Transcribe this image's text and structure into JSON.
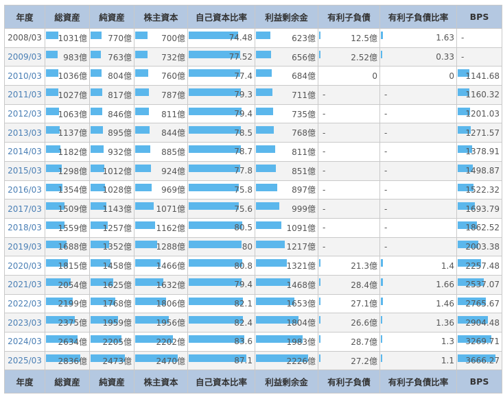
{
  "header": [
    "年度",
    "総資産",
    "純資産",
    "株主資本",
    "自己資本比率",
    "利益剰余金",
    "有利子負債",
    "有利子負債比率",
    "BPS"
  ],
  "no_data": "-",
  "rows": [
    {
      "year": "2008/03",
      "assets": 1031,
      "net": 770,
      "equity": 700,
      "ratio": 74.48,
      "retained": 623,
      "debt": 12.5,
      "debt_unit": "億",
      "debt_ratio": 1.63,
      "bps": null
    },
    {
      "year": "2009/03",
      "assets": 983,
      "net": 763,
      "equity": 732,
      "ratio": 77.52,
      "retained": 656,
      "debt": 2.52,
      "debt_unit": "億",
      "debt_ratio": 0.33,
      "bps": null
    },
    {
      "year": "2010/03",
      "assets": 1036,
      "net": 804,
      "equity": 760,
      "ratio": 77.4,
      "retained": 684,
      "debt": 0,
      "debt_unit": "",
      "debt_ratio": 0,
      "bps": 1141.68
    },
    {
      "year": "2011/03",
      "assets": 1027,
      "net": 817,
      "equity": 787,
      "ratio": 79.3,
      "retained": 711,
      "debt": null,
      "debt_ratio": null,
      "bps": 1160.32
    },
    {
      "year": "2012/03",
      "assets": 1063,
      "net": 846,
      "equity": 811,
      "ratio": 79.4,
      "retained": 735,
      "debt": null,
      "debt_ratio": null,
      "bps": 1201.03
    },
    {
      "year": "2013/03",
      "assets": 1137,
      "net": 895,
      "equity": 844,
      "ratio": 78.5,
      "retained": 768,
      "debt": null,
      "debt_ratio": null,
      "bps": 1271.57
    },
    {
      "year": "2014/03",
      "assets": 1182,
      "net": 932,
      "equity": 885,
      "ratio": 78.7,
      "retained": 811,
      "debt": null,
      "debt_ratio": null,
      "bps": 1378.91
    },
    {
      "year": "2015/03",
      "assets": 1298,
      "net": 1012,
      "equity": 924,
      "ratio": 77.8,
      "retained": 851,
      "debt": null,
      "debt_ratio": null,
      "bps": 1498.87
    },
    {
      "year": "2016/03",
      "assets": 1354,
      "net": 1028,
      "equity": 969,
      "ratio": 75.8,
      "retained": 897,
      "debt": null,
      "debt_ratio": null,
      "bps": 1522.32
    },
    {
      "year": "2017/03",
      "assets": 1509,
      "net": 1143,
      "equity": 1071,
      "ratio": 75.6,
      "retained": 999,
      "debt": null,
      "debt_ratio": null,
      "bps": 1693.79
    },
    {
      "year": "2018/03",
      "assets": 1559,
      "net": 1257,
      "equity": 1162,
      "ratio": 80.5,
      "retained": 1091,
      "debt": null,
      "debt_ratio": null,
      "bps": 1862.52
    },
    {
      "year": "2019/03",
      "assets": 1688,
      "net": 1352,
      "equity": 1288,
      "ratio": 80,
      "retained": 1217,
      "debt": null,
      "debt_ratio": null,
      "bps": 2003.38
    },
    {
      "year": "2020/03",
      "assets": 1815,
      "net": 1458,
      "equity": 1466,
      "ratio": 80.8,
      "retained": 1321,
      "debt": 21.3,
      "debt_unit": "億",
      "debt_ratio": 1.4,
      "bps": 2257.48
    },
    {
      "year": "2021/03",
      "assets": 2054,
      "net": 1625,
      "equity": 1632,
      "ratio": 79.4,
      "retained": 1468,
      "debt": 28.4,
      "debt_unit": "億",
      "debt_ratio": 1.66,
      "bps": 2537.07
    },
    {
      "year": "2022/03",
      "assets": 2199,
      "net": 1768,
      "equity": 1806,
      "ratio": 82.1,
      "retained": 1653,
      "debt": 27.1,
      "debt_unit": "億",
      "debt_ratio": 1.46,
      "bps": 2765.67
    },
    {
      "year": "2023/03",
      "assets": 2375,
      "net": 1959,
      "equity": 1956,
      "ratio": 82.4,
      "retained": 1804,
      "debt": 26.6,
      "debt_unit": "億",
      "debt_ratio": 1.36,
      "bps": 2904.48
    },
    {
      "year": "2024/03",
      "assets": 2634,
      "net": 2205,
      "equity": 2202,
      "ratio": 83.6,
      "retained": 1983,
      "debt": 28.7,
      "debt_unit": "億",
      "debt_ratio": 1.3,
      "bps": 3269.71
    },
    {
      "year": "2025/03",
      "assets": 2836,
      "net": 2473,
      "equity": 2470,
      "ratio": 87.1,
      "retained": 2226,
      "debt": 27.2,
      "debt_unit": "億",
      "debt_ratio": 1.1,
      "bps": 3666.27
    }
  ],
  "unit": "億",
  "colors": {
    "bar": "#5bb7ec",
    "header_bg": "#b4c8e1",
    "link": "#4a7fb5"
  }
}
